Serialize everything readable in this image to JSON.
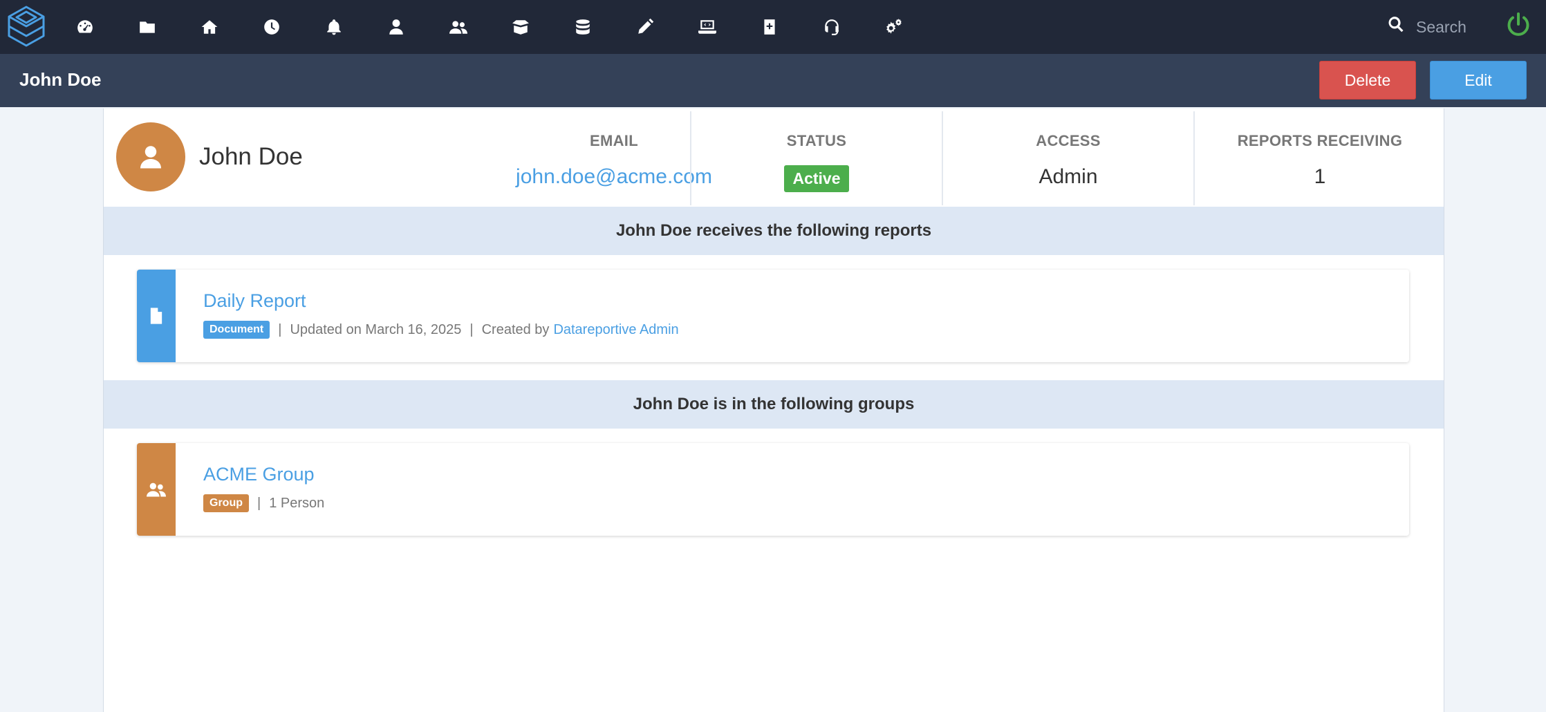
{
  "nav": {
    "icons": [
      "dashboard-gauge-icon",
      "folder-icon",
      "home-icon",
      "history-clock-icon",
      "bell-icon",
      "user-icon",
      "users-icon",
      "box-icon",
      "database-icon",
      "pencil-icon",
      "laptop-code-icon",
      "notebook-plus-icon",
      "headset-icon",
      "settings-gears-icon"
    ],
    "search_placeholder": "Search"
  },
  "header": {
    "title": "John Doe",
    "delete_label": "Delete",
    "edit_label": "Edit"
  },
  "profile": {
    "name": "John Doe",
    "email_label": "EMAIL",
    "email": "john.doe@acme.com",
    "status_label": "STATUS",
    "status": "Active",
    "access_label": "ACCESS",
    "access": "Admin",
    "reports_label": "REPORTS RECEIVING",
    "reports_count": "1"
  },
  "reports_section": {
    "heading": "John Doe receives the following reports",
    "items": [
      {
        "title": "Daily Report",
        "tag": "Document",
        "separator": "|",
        "updated": "Updated on March 16, 2025",
        "created_prefix": "Created by",
        "created_by": "Datareportive Admin"
      }
    ]
  },
  "groups_section": {
    "heading": "John Doe is in the following groups",
    "items": [
      {
        "title": "ACME Group",
        "tag": "Group",
        "separator": "|",
        "members": "1 Person"
      }
    ]
  },
  "colors": {
    "nav_bg": "#212838",
    "subheader_bg": "#344158",
    "accent_blue": "#4a9fe3",
    "danger_red": "#d9534f",
    "success_green": "#4cae4c",
    "group_orange": "#cf8745",
    "power_green": "#4cae4c"
  }
}
